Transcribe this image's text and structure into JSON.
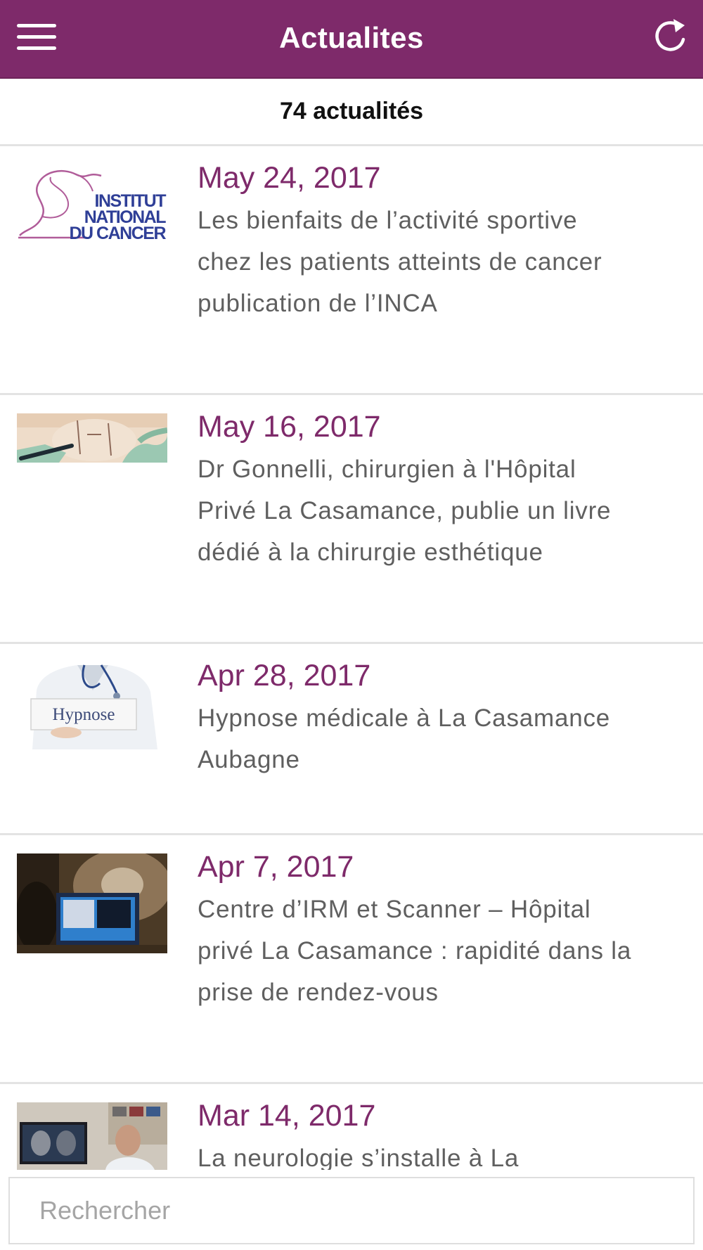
{
  "header": {
    "title": "Actualites",
    "menu_icon": "hamburger-menu-icon",
    "refresh_icon": "refresh-icon",
    "background_color": "#7e2a6a"
  },
  "count": {
    "label": "74 actualités"
  },
  "news": [
    {
      "date": "May 24, 2017",
      "title": "Les bienfaits de l’activité sportive chez les patients atteints de cancer publication de l’INCA",
      "thumbnail": "institut-national-du-cancer-logo",
      "logo_text": [
        "INSTITUT",
        "NATIONAL",
        "DU CANCER"
      ]
    },
    {
      "date": "May 16, 2017",
      "title": "Dr Gonnelli, chirurgien à l'Hôpital Privé La Casamance, publie un livre dédié à la chirurgie esthétique",
      "thumbnail": "surgery-marker-photo"
    },
    {
      "date": "Apr 28, 2017",
      "title": "Hypnose médicale à La Casamance Aubagne",
      "thumbnail": "doctor-hypnose-sign-photo",
      "sign_text": "Hypnose"
    },
    {
      "date": "Apr 7, 2017",
      "title": "Centre d’IRM et Scanner – Hôpital privé La Casamance : rapidité dans la prise de rendez-vous",
      "thumbnail": "mri-scanner-room-photo"
    },
    {
      "date": "Mar 14, 2017",
      "title": "La neurologie s’installe à La",
      "thumbnail": "neurologist-office-photo"
    }
  ],
  "search": {
    "placeholder": "Rechercher",
    "value": ""
  },
  "colors": {
    "accent": "#7e2a6a",
    "body_text": "#5f5f5f",
    "divider": "#e3e3e3"
  }
}
